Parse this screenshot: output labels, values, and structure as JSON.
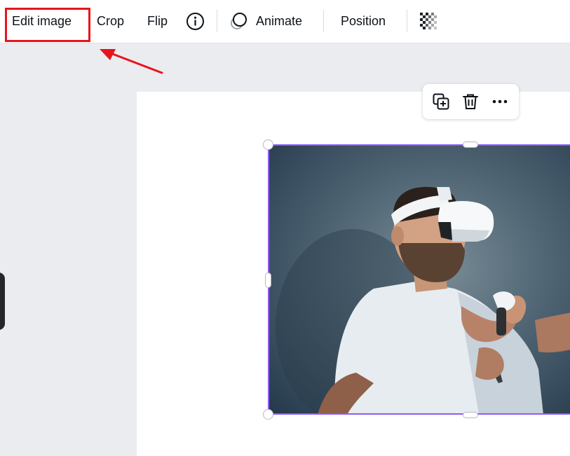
{
  "toolbar": {
    "edit_image_label": "Edit image",
    "crop_label": "Crop",
    "flip_label": "Flip",
    "info_icon": "info-icon",
    "animate_label": "Animate",
    "animate_icon": "animate-icon",
    "position_label": "Position",
    "transparency_icon": "transparency-icon"
  },
  "annotation": {
    "highlight_color": "#e8141b",
    "target": "edit_image_label"
  },
  "floating_menu": {
    "items": [
      {
        "icon": "duplicate-icon"
      },
      {
        "icon": "trash-icon"
      },
      {
        "icon": "more-icon"
      }
    ]
  },
  "selection": {
    "border_color": "#8b5cf6"
  },
  "image": {
    "subject": "photo"
  }
}
